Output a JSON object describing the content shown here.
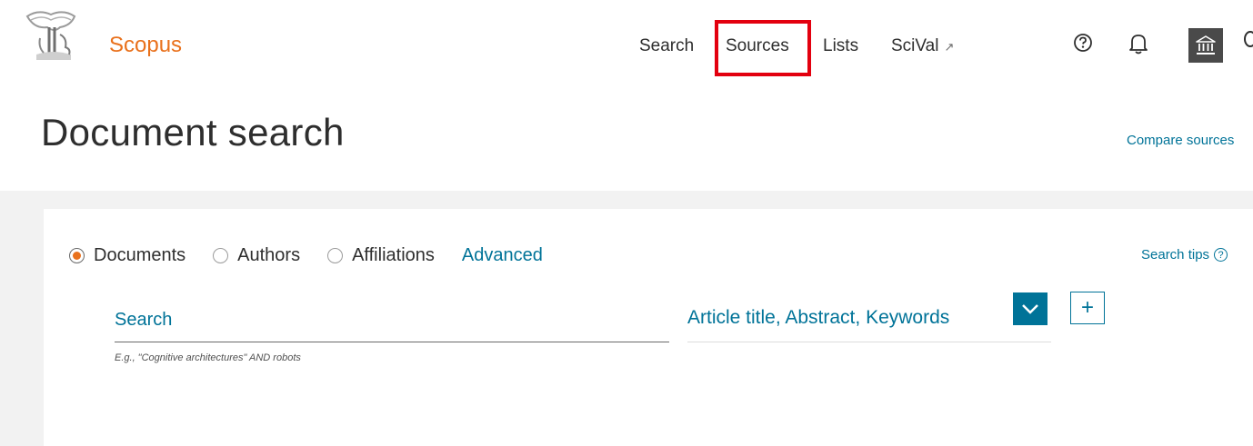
{
  "header": {
    "brand": "Scopus",
    "nav": {
      "search": "Search",
      "sources": "Sources",
      "lists": "Lists",
      "scival": "SciVal",
      "external_glyph": "↗"
    },
    "icons": [
      "elsevier-logo-icon",
      "help-icon",
      "bell-icon",
      "institution-icon"
    ],
    "accent_color": "#e9711c",
    "highlight_color": "#e3000f"
  },
  "page": {
    "title": "Document search",
    "compare_link": "Compare sources"
  },
  "search_form": {
    "options": [
      {
        "label": "Documents",
        "selected": true
      },
      {
        "label": "Authors",
        "selected": false
      },
      {
        "label": "Affiliations",
        "selected": false
      }
    ],
    "advanced": "Advanced",
    "search_tips": "Search tips",
    "search_tips_icon": "?",
    "input_placeholder": "Search",
    "input_hint": "E.g., \"Cognitive architectures\" AND robots",
    "field_selected": "Article title, Abstract, Keywords",
    "add_field_glyph": "+",
    "link_color": "#007398"
  }
}
